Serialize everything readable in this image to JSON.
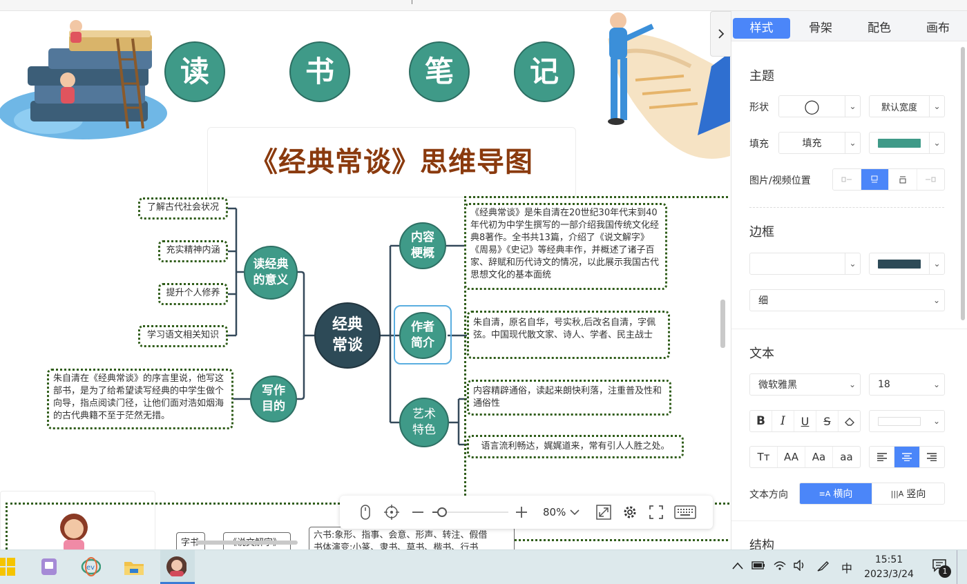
{
  "title_chars": [
    "读",
    "书",
    "笔",
    "记"
  ],
  "main_title": "《经典常谈》思维导图",
  "mindmap": {
    "center": "经典\n常谈",
    "left_branches": [
      {
        "label": "读经典\n的意义",
        "leaves": [
          "了解古代社会状况",
          "充实精神内涵",
          "提升个人修养",
          "学习语文相关知识"
        ]
      },
      {
        "label": "写作\n目的",
        "leaves": [
          "朱自清在《经典常谈》的序言里说，他写这部书，是为了给希望读写经典的中学生做个向导，指点阅读门径，让他们面对浩如烟海的古代典籍不至于茫然无措。"
        ]
      }
    ],
    "right_branches": [
      {
        "label": "内容\n梗概",
        "leaves": [
          "《经典常谈》是朱自清在20世纪30年代末到40年代初为中学生撰写的一部介绍我国传统文化经典8著作。全书共13篇，介绍了《说文解字》《周易》《史记》等经典丰作，并概述了诸子百家、辞赋和历代诗文的情况，以此展示我国古代思想文化的基本面统"
        ]
      },
      {
        "label": "作者\n简介",
        "leaves": [
          "朱自清，原名自华，号实秋,后改名自清，字佩弦。中国现代散文家、诗人、学者、民主战士"
        ]
      },
      {
        "label": "艺术\n特色",
        "leaves": [
          "内容精辟通俗，读起来朗快利落，注重普及性和通俗性",
          "语言流利畅达，娓娓道来，常有引人人胜之处。"
        ]
      }
    ]
  },
  "bottom_peek": {
    "box1": "字书",
    "box2": "《说文解字》",
    "box3": "六书:象形、指事、会意、形声、转注、假借",
    "box3_line2": "书体演变:小篆、隶书、草书、楷书、行书"
  },
  "toolbar": {
    "zoom_label": "80%",
    "zoom_percent": 80,
    "icons": [
      "mouse-icon",
      "locate-icon",
      "zoom-out-icon",
      "zoom-in-icon",
      "fit-view-icon",
      "settings-icon",
      "fullscreen-icon",
      "keyboard-icon"
    ]
  },
  "panel": {
    "tabs": [
      "样式",
      "骨架",
      "配色",
      "画布"
    ],
    "active_tab": "样式",
    "topic_section": "主题",
    "shape_label": "形状",
    "shape_value": "◯",
    "width_value": "默认宽度",
    "fill_label": "填充",
    "fill_value": "填充",
    "fill_color": "#3f9a88",
    "media_position_label": "图片/视频位置",
    "border_section": "边框",
    "border_color": "#2d4a57",
    "border_width_value": "细",
    "text_section": "文本",
    "font_value": "微软雅黑",
    "font_size_value": "18",
    "case_options": [
      "Tт",
      "AA",
      "Aa",
      "aa"
    ],
    "text_direction_label": "文本方向",
    "direction_horizontal": "横向",
    "direction_vertical": "竖向",
    "next_section_partial": "结构"
  },
  "taskbar": {
    "time": "15:51",
    "date": "2023/3/24",
    "ime": "中",
    "notification_count": "1"
  },
  "colors": {
    "node_teal": "#3f9a88",
    "center_node": "#2d4a57",
    "title_brown": "#8a3a0e",
    "leaf_border": "#2f5c19",
    "accent_blue": "#4b86f9"
  }
}
